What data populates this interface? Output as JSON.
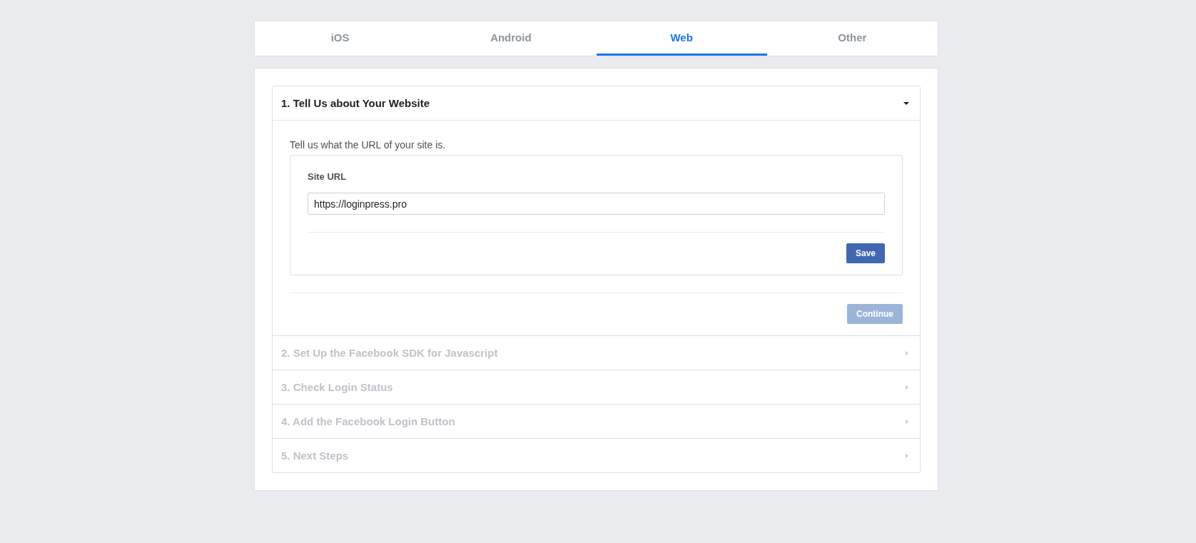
{
  "tabs": [
    {
      "label": "iOS",
      "selected": false
    },
    {
      "label": "Android",
      "selected": false
    },
    {
      "label": "Web",
      "selected": true
    },
    {
      "label": "Other",
      "selected": false
    }
  ],
  "steps": [
    {
      "title": "1. Tell Us about Your Website",
      "expanded": true,
      "disabled": false,
      "content": {
        "intro": "Tell us what the URL of your site is.",
        "field_label": "Site URL",
        "field_value": "https://loginpress.pro",
        "save_button": "Save",
        "continue_button": {
          "label": "Continue",
          "disabled": true
        }
      }
    },
    {
      "title": "2. Set Up the Facebook SDK for Javascript",
      "expanded": false,
      "disabled": true
    },
    {
      "title": "3. Check Login Status",
      "expanded": false,
      "disabled": true
    },
    {
      "title": "4. Add the Facebook Login Button",
      "expanded": false,
      "disabled": true
    },
    {
      "title": "5. Next Steps",
      "expanded": false,
      "disabled": true
    }
  ]
}
